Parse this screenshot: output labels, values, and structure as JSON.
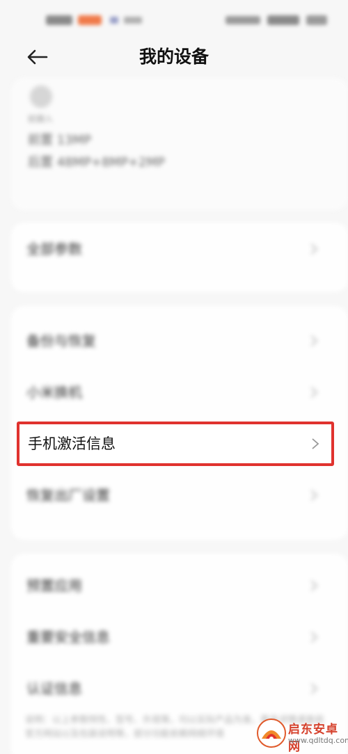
{
  "header": {
    "title": "我的设备"
  },
  "camera": {
    "caption": "前摄入",
    "front": "前置 13MP",
    "rear": "后置 48MP+8MP+2MP"
  },
  "sections": {
    "all_params": "全部参数",
    "backup_restore": "备份与恢复",
    "mi_move": "小米换机",
    "activation_info": "手机激活信息",
    "factory_reset": "恢复出厂设置",
    "preinstalled_apps": "预置应用",
    "safety_info": "重要安全信息",
    "certification": "认证信息"
  },
  "footnote": "说明：以上参数特性、型号、外观等，均以实际产品为准，更多详情请查阅官方网站以及包装说明等，部分功能依赖网络环境",
  "watermark": {
    "name": "启东安卓网",
    "url": "www.qdltdq.com"
  },
  "colors": {
    "highlight": "#e0322e",
    "background": "#f7f7f7"
  }
}
